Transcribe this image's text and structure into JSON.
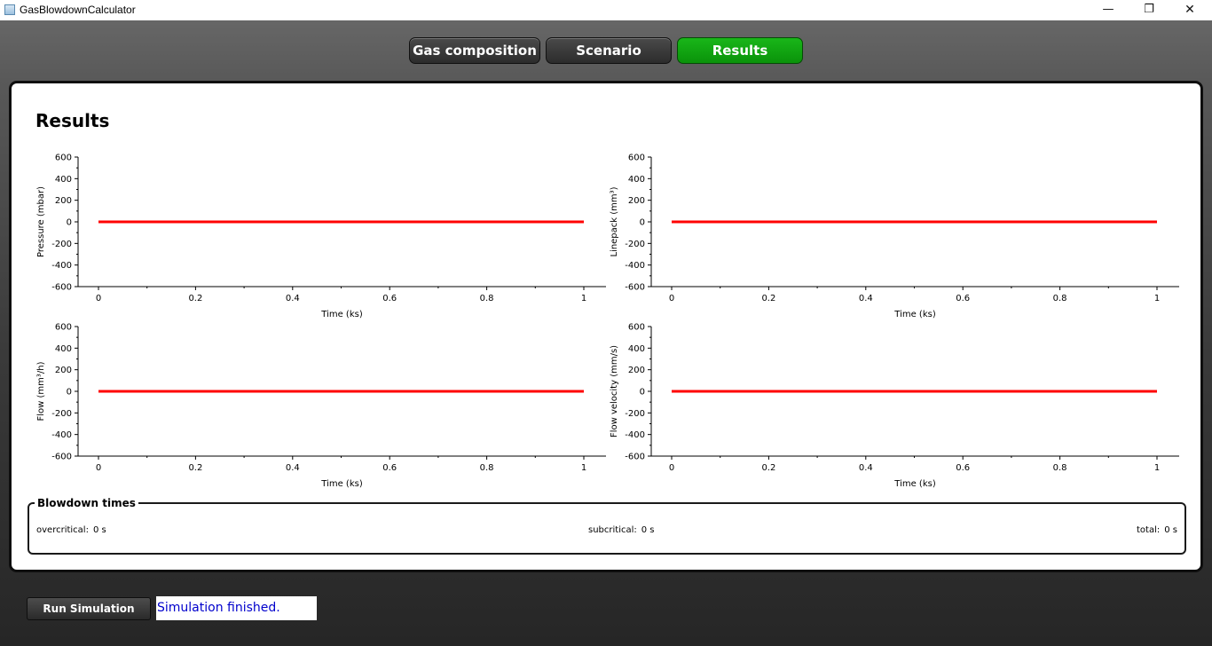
{
  "window": {
    "title": "GasBlowdownCalculator",
    "minimize": "—",
    "maximize": "❐",
    "close": "✕"
  },
  "tabs": [
    {
      "label": "Gas composition",
      "active": false
    },
    {
      "label": "Scenario",
      "active": false
    },
    {
      "label": "Results",
      "active": true
    }
  ],
  "colors": {
    "active_tab": "#0fa30f",
    "series": "#ff0000",
    "status_text": "#0000cc"
  },
  "results": {
    "heading": "Results"
  },
  "chart_data": [
    {
      "type": "line",
      "xlabel": "Time (ks)",
      "ylabel": "Pressure (mbar)",
      "xlim": [
        0,
        1
      ],
      "ylim": [
        -600,
        600
      ],
      "xticks": [
        "0",
        "0.2",
        "0.4",
        "0.6",
        "0.8",
        "1"
      ],
      "yticks": [
        "600",
        "400",
        "200",
        "0",
        "-200",
        "-400",
        "-600"
      ],
      "x": [
        0,
        1
      ],
      "y": [
        0,
        0
      ]
    },
    {
      "type": "line",
      "xlabel": "Time (ks)",
      "ylabel": "Linepack (mm³)",
      "xlim": [
        0,
        1
      ],
      "ylim": [
        -600,
        600
      ],
      "xticks": [
        "0",
        "0.2",
        "0.4",
        "0.6",
        "0.8",
        "1"
      ],
      "yticks": [
        "600",
        "400",
        "200",
        "0",
        "-200",
        "-400",
        "-600"
      ],
      "x": [
        0,
        1
      ],
      "y": [
        0,
        0
      ]
    },
    {
      "type": "line",
      "xlabel": "Time (ks)",
      "ylabel": "Flow (mm³/h)",
      "xlim": [
        0,
        1
      ],
      "ylim": [
        -600,
        600
      ],
      "xticks": [
        "0",
        "0.2",
        "0.4",
        "0.6",
        "0.8",
        "1"
      ],
      "yticks": [
        "600",
        "400",
        "200",
        "0",
        "-200",
        "-400",
        "-600"
      ],
      "x": [
        0,
        1
      ],
      "y": [
        0,
        0
      ]
    },
    {
      "type": "line",
      "xlabel": "Time (ks)",
      "ylabel": "Flow velocity (mm/s)",
      "xlim": [
        0,
        1
      ],
      "ylim": [
        -600,
        600
      ],
      "xticks": [
        "0",
        "0.2",
        "0.4",
        "0.6",
        "0.8",
        "1"
      ],
      "yticks": [
        "600",
        "400",
        "200",
        "0",
        "-200",
        "-400",
        "-600"
      ],
      "x": [
        0,
        1
      ],
      "y": [
        0,
        0
      ]
    }
  ],
  "blowdown": {
    "title": "Blowdown times",
    "overcritical_label": "overcritical:",
    "overcritical_value": "0 s",
    "subcritical_label": "subcritical:",
    "subcritical_value": "0 s",
    "total_label": "total:",
    "total_value": "0 s"
  },
  "footer": {
    "run_button": "Run Simulation",
    "status": "Simulation finished."
  }
}
